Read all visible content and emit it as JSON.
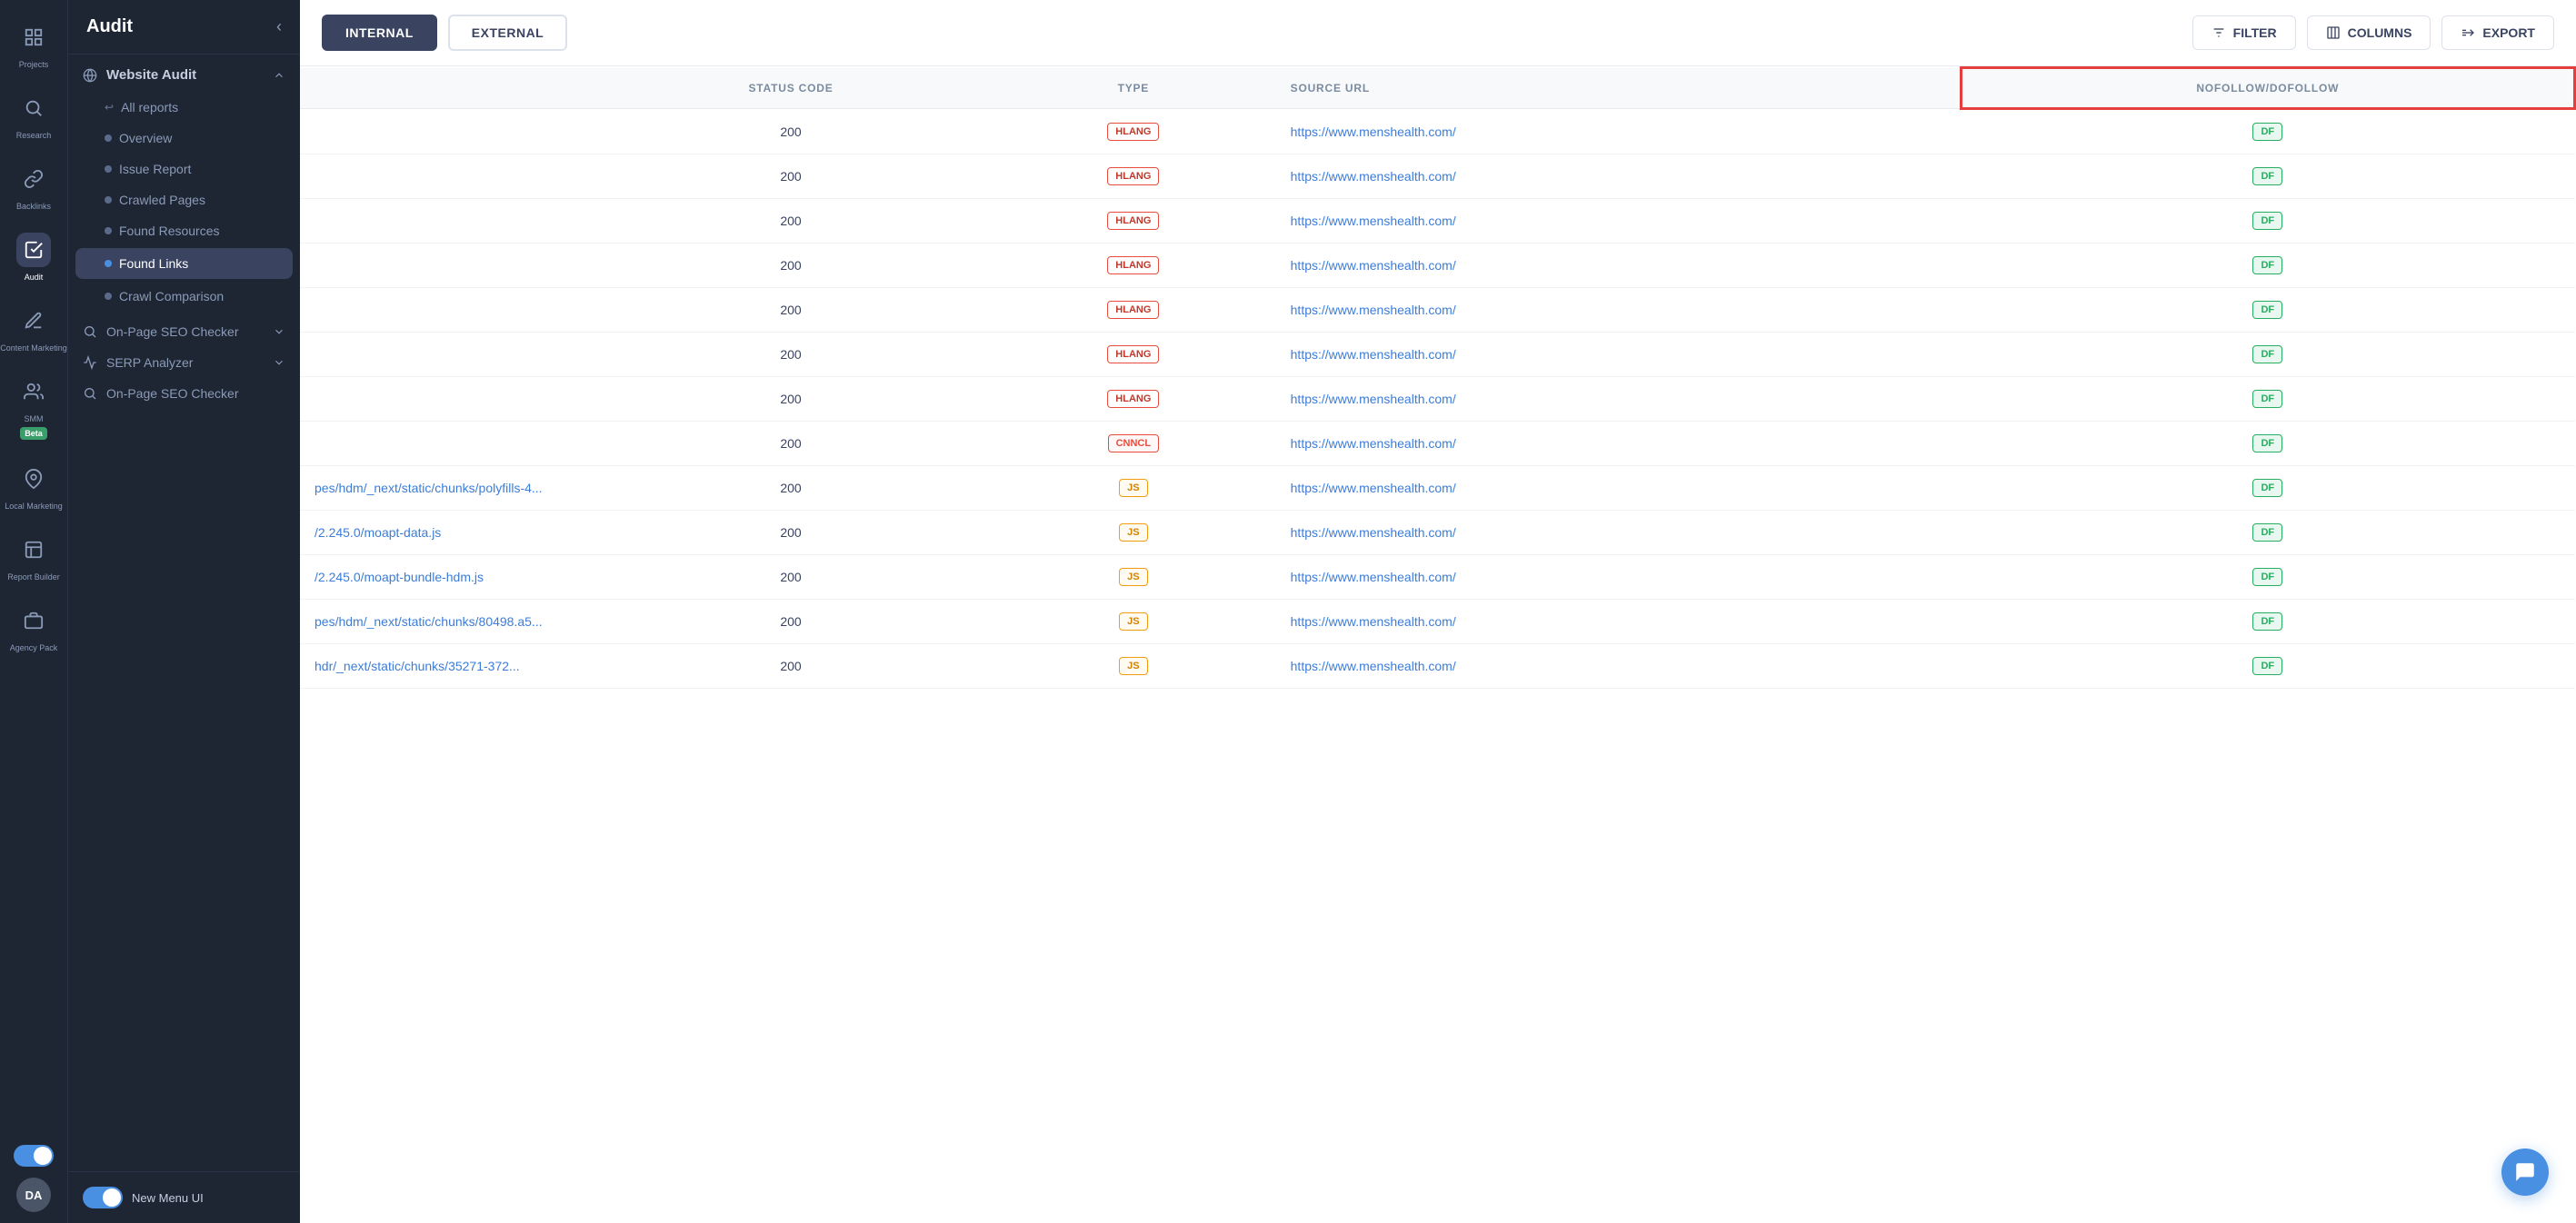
{
  "sidebar": {
    "title": "Audit",
    "nav_items": [
      {
        "id": "projects",
        "label": "Projects",
        "icon": "grid-icon"
      },
      {
        "id": "research",
        "label": "Research",
        "icon": "search-icon"
      },
      {
        "id": "backlinks",
        "label": "Backlinks",
        "icon": "link-icon"
      },
      {
        "id": "audit",
        "label": "Audit",
        "icon": "audit-icon",
        "active": true
      },
      {
        "id": "content_marketing",
        "label": "Content Marketing",
        "icon": "content-icon"
      },
      {
        "id": "smm",
        "label": "SMM",
        "icon": "smm-icon",
        "badge": "Beta"
      },
      {
        "id": "local_marketing",
        "label": "Local Marketing",
        "icon": "location-icon"
      },
      {
        "id": "report_builder",
        "label": "Report Builder",
        "icon": "report-icon"
      },
      {
        "id": "agency_pack",
        "label": "Agency Pack",
        "icon": "agency-icon"
      }
    ],
    "website_audit": {
      "label": "Website Audit",
      "items": [
        {
          "id": "all_reports",
          "label": "All reports",
          "indent": true
        },
        {
          "id": "overview",
          "label": "Overview",
          "indent": true
        },
        {
          "id": "issue_report",
          "label": "Issue Report",
          "indent": true
        },
        {
          "id": "crawled_pages",
          "label": "Crawled Pages",
          "indent": true
        },
        {
          "id": "found_resources",
          "label": "Found Resources",
          "indent": true
        },
        {
          "id": "found_links",
          "label": "Found Links",
          "indent": true,
          "active": true
        },
        {
          "id": "crawl_comparison",
          "label": "Crawl Comparison",
          "indent": true
        }
      ]
    },
    "sub_sections": [
      {
        "id": "on_page_seo",
        "label": "On-Page SEO Checker",
        "icon": "search-circle-icon"
      },
      {
        "id": "serp_analyzer",
        "label": "SERP Analyzer",
        "icon": "chart-icon"
      },
      {
        "id": "on_page_seo2",
        "label": "On-Page SEO Checker",
        "icon": "search-circle-icon"
      }
    ],
    "toggle_label": "New Menu UI",
    "avatar_initials": "DA"
  },
  "toolbar": {
    "tabs": [
      {
        "id": "internal",
        "label": "INTERNAL",
        "active": true
      },
      {
        "id": "external",
        "label": "EXTERNAL",
        "active": false
      }
    ],
    "buttons": [
      {
        "id": "filter",
        "label": "FILTER",
        "icon": "filter-icon"
      },
      {
        "id": "columns",
        "label": "COLUMNS",
        "icon": "columns-icon"
      },
      {
        "id": "export",
        "label": "EXPORT",
        "icon": "export-icon"
      }
    ]
  },
  "table": {
    "columns": [
      {
        "id": "url",
        "label": ""
      },
      {
        "id": "status_code",
        "label": "STATUS CODE"
      },
      {
        "id": "type",
        "label": "TYPE"
      },
      {
        "id": "source_url",
        "label": "SOURCE URL"
      },
      {
        "id": "nofollow_dofollow",
        "label": "NOFOLLOW/DOFOLLOW",
        "highlighted": true
      }
    ],
    "rows": [
      {
        "url": "",
        "status_code": "200",
        "type": "HLANG",
        "type_class": "hlang",
        "source_url": "https://www.menshealth.com/",
        "nofollow": "DF"
      },
      {
        "url": "",
        "status_code": "200",
        "type": "HLANG",
        "type_class": "hlang",
        "source_url": "https://www.menshealth.com/",
        "nofollow": "DF"
      },
      {
        "url": "",
        "status_code": "200",
        "type": "HLANG",
        "type_class": "hlang",
        "source_url": "https://www.menshealth.com/",
        "nofollow": "DF"
      },
      {
        "url": "",
        "status_code": "200",
        "type": "HLANG",
        "type_class": "hlang",
        "source_url": "https://www.menshealth.com/",
        "nofollow": "DF"
      },
      {
        "url": "",
        "status_code": "200",
        "type": "HLANG",
        "type_class": "hlang",
        "source_url": "https://www.menshealth.com/",
        "nofollow": "DF"
      },
      {
        "url": "",
        "status_code": "200",
        "type": "HLANG",
        "type_class": "hlang",
        "source_url": "https://www.menshealth.com/",
        "nofollow": "DF"
      },
      {
        "url": "",
        "status_code": "200",
        "type": "HLANG",
        "type_class": "hlang",
        "source_url": "https://www.menshealth.com/",
        "nofollow": "DF"
      },
      {
        "url": "",
        "status_code": "200",
        "type": "CNNCL",
        "type_class": "cnncl",
        "source_url": "https://www.menshealth.com/",
        "nofollow": "DF"
      },
      {
        "url": "pes/hdm/_next/static/chunks/polyfills-4...",
        "status_code": "200",
        "type": "JS",
        "type_class": "js",
        "source_url": "https://www.menshealth.com/",
        "nofollow": "DF"
      },
      {
        "url": "/2.245.0/moapt-data.js",
        "status_code": "200",
        "type": "JS",
        "type_class": "js",
        "source_url": "https://www.menshealth.com/",
        "nofollow": "DF"
      },
      {
        "url": "/2.245.0/moapt-bundle-hdm.js",
        "status_code": "200",
        "type": "JS",
        "type_class": "js",
        "source_url": "https://www.menshealth.com/",
        "nofollow": "DF"
      },
      {
        "url": "pes/hdm/_next/static/chunks/80498.a5...",
        "status_code": "200",
        "type": "JS",
        "type_class": "js",
        "source_url": "https://www.menshealth.com/",
        "nofollow": "DF"
      },
      {
        "url": "hdr/_next/static/chunks/35271-372...",
        "status_code": "200",
        "type": "JS",
        "type_class": "js",
        "source_url": "https://www.menshealth.com/",
        "nofollow": "DF"
      }
    ]
  }
}
